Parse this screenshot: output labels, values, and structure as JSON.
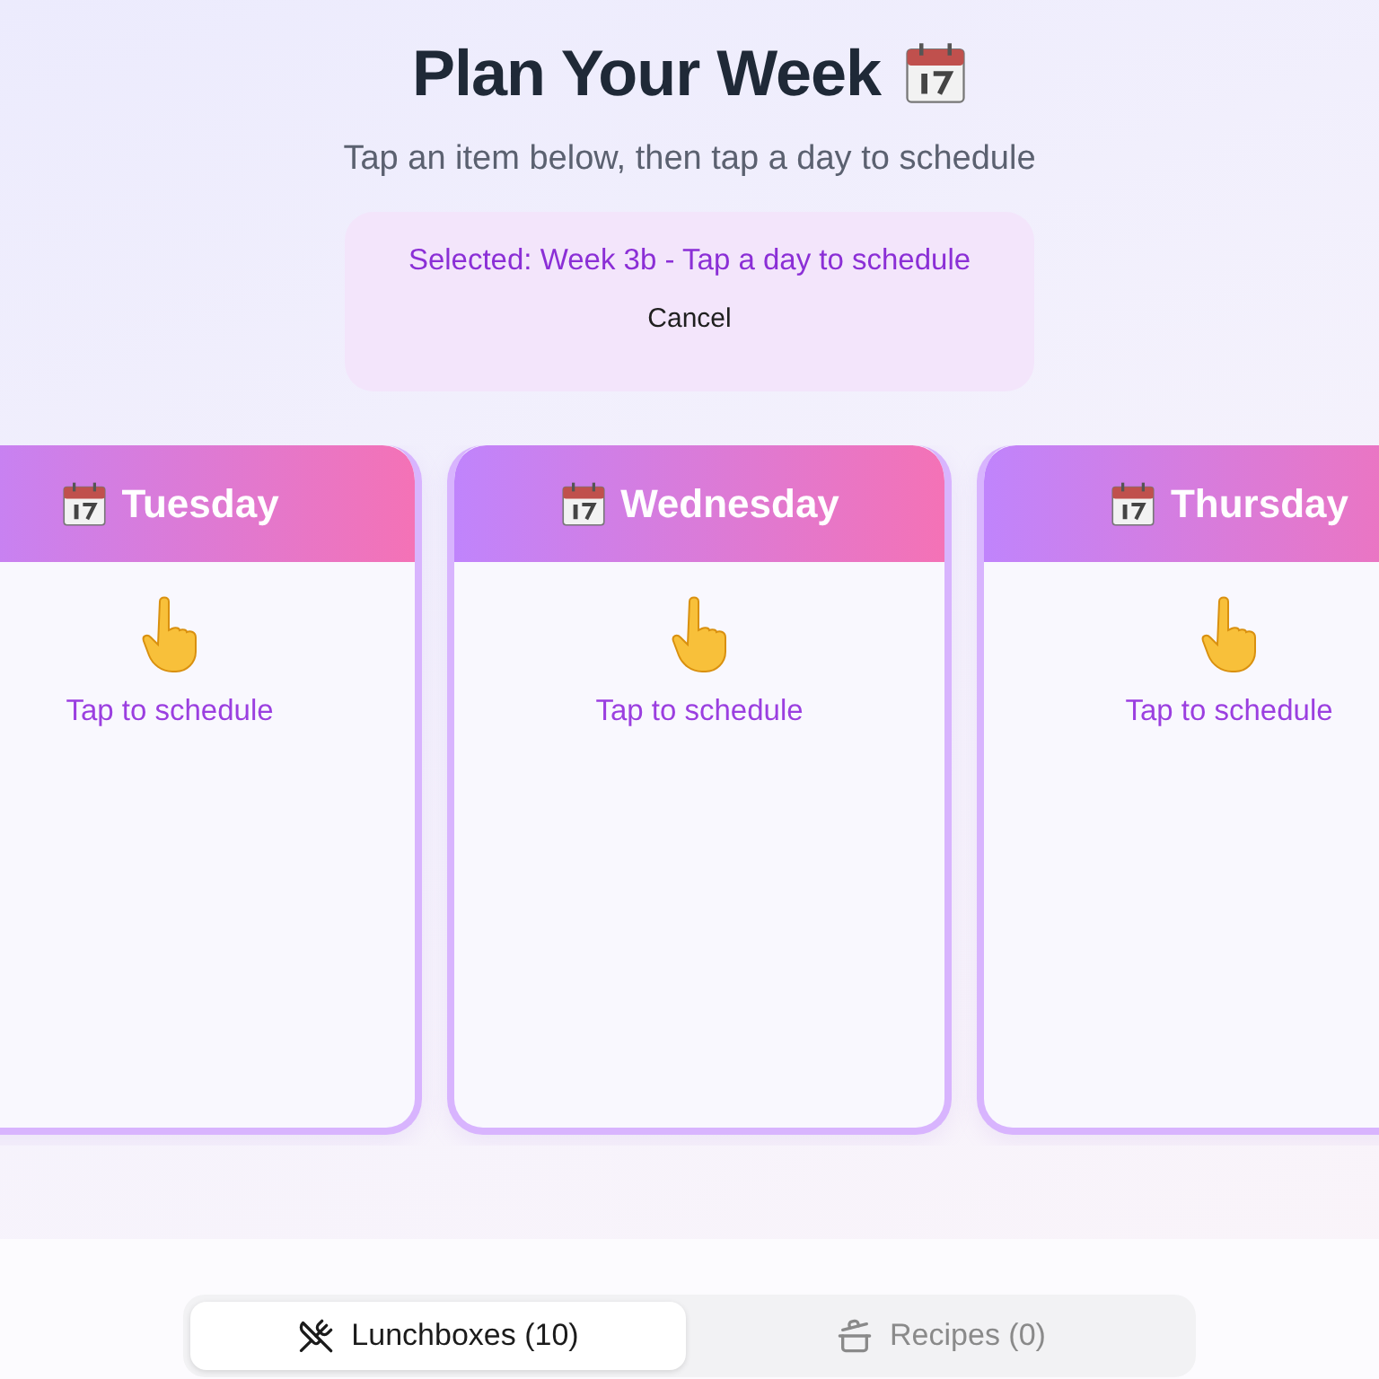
{
  "header": {
    "title": "Plan Your Week",
    "subtitle": "Tap an item below, then tap a day to schedule"
  },
  "selection_banner": {
    "message": "Selected: Week 3b - Tap a day to schedule",
    "cancel": "Cancel"
  },
  "days": [
    {
      "name": "Tuesday",
      "prompt": "Tap to schedule"
    },
    {
      "name": "Wednesday",
      "prompt": "Tap to schedule"
    },
    {
      "name": "Thursday",
      "prompt": "Tap to schedule"
    }
  ],
  "tabs": [
    {
      "kind": "lunchboxes",
      "label": "Lunchboxes (10)",
      "selected": true
    },
    {
      "kind": "recipes",
      "label": "Recipes (0)",
      "selected": false
    }
  ]
}
